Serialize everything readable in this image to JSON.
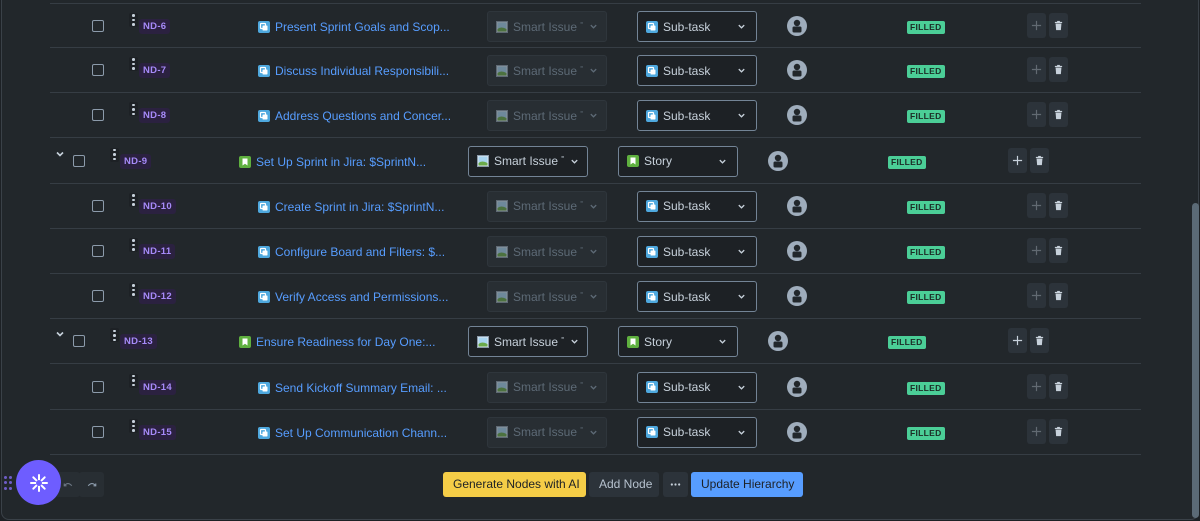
{
  "colors": {
    "background": "#22272b",
    "link": "#579dff",
    "node_id_text": "#a78bfa",
    "node_id_bg": "#2b2140",
    "badge_bg": "#4bce97",
    "subtask_icon": "#4ea8de",
    "story_icon": "#5fb03f",
    "generate_button": "#f5cd47",
    "update_button": "#579dff",
    "fab": "#6e5dff"
  },
  "rows": [
    {
      "id": "ND-6",
      "title": "Present Sprint Goals and Scop...",
      "level": "child",
      "issue_icon": "subtask-icon",
      "smart_select": "Smart Issue T",
      "smart_select_enabled": false,
      "type": "Sub-task",
      "status": "FILLED",
      "add_enabled": false,
      "expanded": null
    },
    {
      "id": "ND-7",
      "title": "Discuss Individual Responsibili...",
      "level": "child",
      "issue_icon": "subtask-icon",
      "smart_select": "Smart Issue T",
      "smart_select_enabled": false,
      "type": "Sub-task",
      "status": "FILLED",
      "add_enabled": false,
      "expanded": null
    },
    {
      "id": "ND-8",
      "title": "Address Questions and Concer...",
      "level": "child",
      "issue_icon": "subtask-icon",
      "smart_select": "Smart Issue T",
      "smart_select_enabled": false,
      "type": "Sub-task",
      "status": "FILLED",
      "add_enabled": false,
      "expanded": null
    },
    {
      "id": "ND-9",
      "title": "Set Up Sprint in Jira: $SprintN...",
      "level": "parent",
      "issue_icon": "story-icon",
      "smart_select": "Smart Issue T",
      "smart_select_enabled": true,
      "type": "Story",
      "status": "FILLED",
      "add_enabled": true,
      "expanded": true
    },
    {
      "id": "ND-10",
      "title": "Create Sprint in Jira: $SprintN...",
      "level": "child",
      "issue_icon": "subtask-icon",
      "smart_select": "Smart Issue T",
      "smart_select_enabled": false,
      "type": "Sub-task",
      "status": "FILLED",
      "add_enabled": false,
      "expanded": null
    },
    {
      "id": "ND-11",
      "title": "Configure Board and Filters: $...",
      "level": "child",
      "issue_icon": "subtask-icon",
      "smart_select": "Smart Issue T",
      "smart_select_enabled": false,
      "type": "Sub-task",
      "status": "FILLED",
      "add_enabled": false,
      "expanded": null
    },
    {
      "id": "ND-12",
      "title": "Verify Access and Permissions...",
      "level": "child",
      "issue_icon": "subtask-icon",
      "smart_select": "Smart Issue T",
      "smart_select_enabled": false,
      "type": "Sub-task",
      "status": "FILLED",
      "add_enabled": false,
      "expanded": null
    },
    {
      "id": "ND-13",
      "title": "Ensure Readiness for Day One:...",
      "level": "parent",
      "issue_icon": "story-icon",
      "smart_select": "Smart Issue T",
      "smart_select_enabled": true,
      "type": "Story",
      "status": "FILLED",
      "add_enabled": true,
      "expanded": true
    },
    {
      "id": "ND-14",
      "title": "Send Kickoff Summary Email: ...",
      "level": "child",
      "issue_icon": "subtask-icon",
      "smart_select": "Smart Issue T",
      "smart_select_enabled": false,
      "type": "Sub-task",
      "status": "FILLED",
      "add_enabled": false,
      "expanded": null
    },
    {
      "id": "ND-15",
      "title": "Set Up Communication Chann...",
      "level": "child",
      "issue_icon": "subtask-icon",
      "smart_select": "Smart Issue T",
      "smart_select_enabled": false,
      "type": "Sub-task",
      "status": "FILLED",
      "add_enabled": false,
      "expanded": null
    }
  ],
  "toolbar": {
    "generate_label": "Generate Nodes with AI",
    "add_node_label": "Add Node",
    "more_icon": "ellipsis-icon",
    "update_label": "Update Hierarchy",
    "undo_icon": "undo-icon",
    "redo_icon": "redo-icon"
  },
  "fab": {
    "icon": "sparkle-icon"
  },
  "scrollbar": {
    "position_fraction": 0.4
  }
}
